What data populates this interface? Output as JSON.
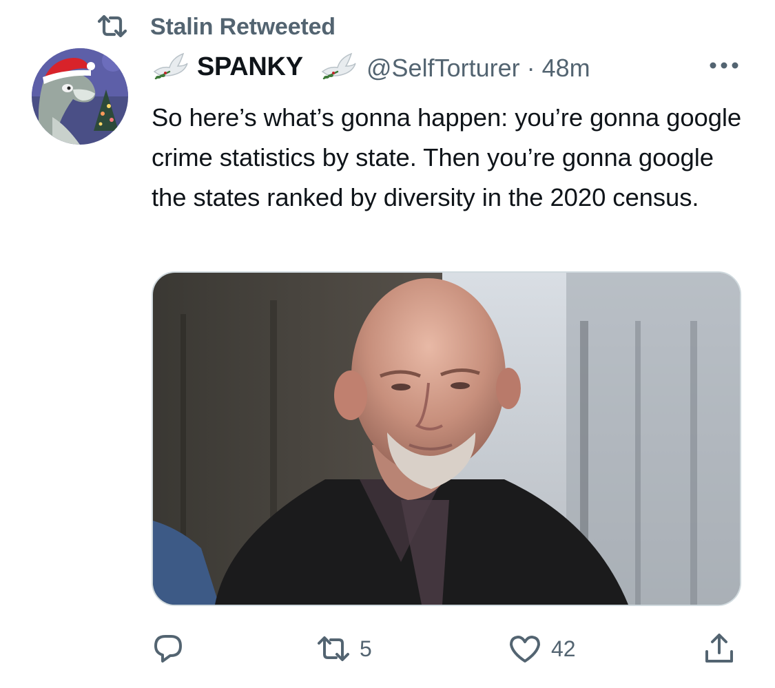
{
  "social_context": {
    "label": "Stalin Retweeted",
    "icon": "retweet-icon"
  },
  "author": {
    "display_name": "SPANKY",
    "handle": "@SelfTorturer",
    "separator": "·",
    "time_ago": "48m",
    "avatar_icon": "avatar-cartoon-wolf-santa-hat",
    "name_emoji": "dove-with-olive-branch-icon"
  },
  "tweet": {
    "text": "So here’s what’s gonna happen: you’re gonna google crime statistics by state. Then you’re gonna google the states ranked by diversity in the 2020 census."
  },
  "media": {
    "type": "photo",
    "subject": "bald-older-man-dark-jacket-photo"
  },
  "actions": {
    "reply": {
      "icon": "reply-icon",
      "count": ""
    },
    "retweet": {
      "icon": "retweet-icon",
      "count": "5"
    },
    "like": {
      "icon": "heart-icon",
      "count": "42"
    },
    "share": {
      "icon": "share-icon",
      "count": ""
    }
  },
  "colors": {
    "text_primary": "#0f1419",
    "text_secondary": "#536471",
    "border": "#cfd9de"
  }
}
